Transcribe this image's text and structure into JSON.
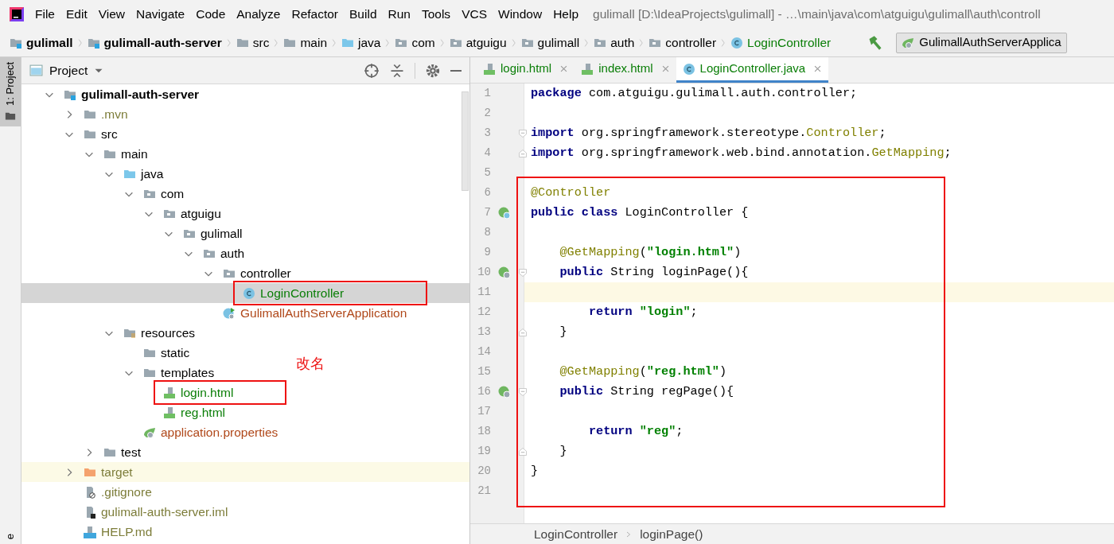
{
  "window": {
    "title": "gulimall [D:\\IdeaProjects\\gulimall] - …\\main\\java\\com\\atguigu\\gulimall\\auth\\controll"
  },
  "menu": [
    "File",
    "Edit",
    "View",
    "Navigate",
    "Code",
    "Analyze",
    "Refactor",
    "Build",
    "Run",
    "Tools",
    "VCS",
    "Window",
    "Help"
  ],
  "breadcrumb": [
    {
      "label": "gulimall",
      "kind": "module"
    },
    {
      "label": "gulimall-auth-server",
      "kind": "module"
    },
    {
      "label": "src",
      "kind": "folder"
    },
    {
      "label": "main",
      "kind": "folder"
    },
    {
      "label": "java",
      "kind": "source_folder"
    },
    {
      "label": "com",
      "kind": "package"
    },
    {
      "label": "atguigu",
      "kind": "package"
    },
    {
      "label": "gulimall",
      "kind": "package"
    },
    {
      "label": "auth",
      "kind": "package"
    },
    {
      "label": "controller",
      "kind": "package"
    },
    {
      "label": "LoginController",
      "kind": "class"
    }
  ],
  "run_config": {
    "label": "GulimallAuthServerApplica"
  },
  "side_tabs": [
    {
      "label": "1: Project",
      "selected": true
    },
    {
      "label": "e",
      "selected": false
    }
  ],
  "project_panel": {
    "title": "Project",
    "annotation": "改名"
  },
  "tree": [
    {
      "label": "gulimall-auth-server",
      "kind": "module",
      "expanded": true,
      "selected": false,
      "marked": false,
      "color": "#000000",
      "children": [
        {
          "label": ".mvn",
          "kind": "folder",
          "expanded": false,
          "selected": false,
          "marked": false,
          "color": "#7d7d3a"
        },
        {
          "label": "src",
          "kind": "folder",
          "expanded": true,
          "selected": false,
          "marked": false,
          "color": "#000000",
          "children": [
            {
              "label": "main",
              "kind": "folder",
              "expanded": true,
              "selected": false,
              "marked": false,
              "color": "#000000",
              "children": [
                {
                  "label": "java",
                  "kind": "source_folder",
                  "expanded": true,
                  "selected": false,
                  "marked": false,
                  "color": "#000000",
                  "children": [
                    {
                      "label": "com",
                      "kind": "package",
                      "expanded": true,
                      "selected": false,
                      "marked": false,
                      "color": "#000000",
                      "children": [
                        {
                          "label": "atguigu",
                          "kind": "package",
                          "expanded": true,
                          "selected": false,
                          "marked": false,
                          "color": "#000000",
                          "children": [
                            {
                              "label": "gulimall",
                              "kind": "package",
                              "expanded": true,
                              "selected": false,
                              "marked": false,
                              "color": "#000000",
                              "children": [
                                {
                                  "label": "auth",
                                  "kind": "package",
                                  "expanded": true,
                                  "selected": false,
                                  "marked": false,
                                  "color": "#000000",
                                  "children": [
                                    {
                                      "label": "controller",
                                      "kind": "package",
                                      "expanded": true,
                                      "selected": false,
                                      "marked": false,
                                      "color": "#000000",
                                      "children": [
                                        {
                                          "label": "LoginController",
                                          "kind": "class",
                                          "selected": true,
                                          "marked": true,
                                          "color": "#0a7e07"
                                        }
                                      ]
                                    },
                                    {
                                      "label": "GulimallAuthServerApplication",
                                      "kind": "boot_class",
                                      "selected": false,
                                      "marked": false,
                                      "color": "#b0481a"
                                    }
                                  ]
                                }
                              ]
                            }
                          ]
                        }
                      ]
                    }
                  ]
                },
                {
                  "label": "resources",
                  "kind": "resources",
                  "expanded": true,
                  "selected": false,
                  "marked": false,
                  "color": "#000000",
                  "children": [
                    {
                      "label": "static",
                      "kind": "folder",
                      "selected": false,
                      "marked": false,
                      "color": "#000000"
                    },
                    {
                      "label": "templates",
                      "kind": "folder",
                      "expanded": true,
                      "selected": false,
                      "marked": false,
                      "color": "#000000",
                      "children": [
                        {
                          "label": "login.html",
                          "kind": "html",
                          "selected": false,
                          "marked": true,
                          "color": "#0a7e07"
                        },
                        {
                          "label": "reg.html",
                          "kind": "html",
                          "selected": false,
                          "marked": false,
                          "color": "#0a7e07"
                        }
                      ]
                    },
                    {
                      "label": "application.properties",
                      "kind": "properties",
                      "selected": false,
                      "marked": false,
                      "color": "#b0481a"
                    }
                  ]
                }
              ]
            },
            {
              "label": "test",
              "kind": "folder",
              "expanded": false,
              "selected": false,
              "marked": false,
              "color": "#000000"
            }
          ]
        },
        {
          "label": "target",
          "kind": "excluded_folder",
          "expanded": false,
          "selected": false,
          "marked": false,
          "color": "#7d7d3a"
        },
        {
          "label": ".gitignore",
          "kind": "ignore_file",
          "selected": false,
          "marked": false,
          "color": "#7d7d3a"
        },
        {
          "label": "gulimall-auth-server.iml",
          "kind": "iml_file",
          "selected": false,
          "marked": false,
          "color": "#7d7d3a"
        },
        {
          "label": "HELP.md",
          "kind": "md_file",
          "selected": false,
          "marked": false,
          "color": "#7d7d3a"
        }
      ]
    }
  ],
  "editor_tabs": [
    {
      "label": "login.html",
      "kind": "html",
      "selected": false
    },
    {
      "label": "index.html",
      "kind": "html",
      "selected": false
    },
    {
      "label": "LoginController.java",
      "kind": "class",
      "selected": true
    }
  ],
  "code": [
    {
      "n": "1",
      "tokens": [
        {
          "kind": "keyword",
          "text": "package"
        },
        {
          "kind": "plain",
          "text": " com.atguigu.gulimall.auth.controller;"
        }
      ],
      "current": false
    },
    {
      "n": "2",
      "current": false
    },
    {
      "n": "3",
      "tokens": [
        {
          "kind": "keyword",
          "text": "import"
        },
        {
          "kind": "plain",
          "text": " org.springframework.stereotype."
        },
        {
          "kind": "annotation",
          "text": "Controller"
        },
        {
          "kind": "plain",
          "text": ";"
        }
      ],
      "fold": {
        "kind": "start"
      },
      "current": false
    },
    {
      "n": "4",
      "tokens": [
        {
          "kind": "keyword",
          "text": "import"
        },
        {
          "kind": "plain",
          "text": " org.springframework.web.bind.annotation."
        },
        {
          "kind": "annotation",
          "text": "GetMapping"
        },
        {
          "kind": "plain",
          "text": ";"
        }
      ],
      "fold": {
        "kind": "end"
      },
      "current": false
    },
    {
      "n": "5",
      "current": false
    },
    {
      "n": "6",
      "tokens": [
        {
          "kind": "annotation",
          "text": "@Controller"
        }
      ],
      "current": false
    },
    {
      "n": "7",
      "tokens": [
        {
          "kind": "keyword",
          "text": "public class"
        },
        {
          "kind": "plain",
          "text": " LoginController {"
        }
      ],
      "gutter": {
        "kind": "bean_class"
      },
      "current": false
    },
    {
      "n": "8",
      "current": false
    },
    {
      "n": "9",
      "tokens": [
        {
          "kind": "annotation",
          "text": "    @GetMapping"
        },
        {
          "kind": "plain",
          "text": "("
        },
        {
          "kind": "string",
          "text": "\"login.html\""
        },
        {
          "kind": "plain",
          "text": ")"
        }
      ],
      "current": false
    },
    {
      "n": "10",
      "tokens": [
        {
          "kind": "keyword",
          "text": "    public"
        },
        {
          "kind": "plain",
          "text": " String loginPage(){"
        }
      ],
      "gutter": {
        "kind": "bean_method"
      },
      "fold": {
        "kind": "start"
      },
      "current": false
    },
    {
      "n": "11",
      "current": true
    },
    {
      "n": "12",
      "tokens": [
        {
          "kind": "keyword",
          "text": "        return"
        },
        {
          "kind": "string",
          "text": " \"login\""
        },
        {
          "kind": "plain",
          "text": ";"
        }
      ],
      "current": false
    },
    {
      "n": "13",
      "tokens": [
        {
          "kind": "plain",
          "text": "    }"
        }
      ],
      "fold": {
        "kind": "end"
      },
      "current": false
    },
    {
      "n": "14",
      "current": false
    },
    {
      "n": "15",
      "tokens": [
        {
          "kind": "annotation",
          "text": "    @GetMapping"
        },
        {
          "kind": "plain",
          "text": "("
        },
        {
          "kind": "string",
          "text": "\"reg.html\""
        },
        {
          "kind": "plain",
          "text": ")"
        }
      ],
      "current": false
    },
    {
      "n": "16",
      "tokens": [
        {
          "kind": "keyword",
          "text": "    public"
        },
        {
          "kind": "plain",
          "text": " String regPage(){"
        }
      ],
      "gutter": {
        "kind": "bean_method"
      },
      "fold": {
        "kind": "start"
      },
      "current": false
    },
    {
      "n": "17",
      "current": false
    },
    {
      "n": "18",
      "tokens": [
        {
          "kind": "keyword",
          "text": "        return"
        },
        {
          "kind": "string",
          "text": " \"reg\""
        },
        {
          "kind": "plain",
          "text": ";"
        }
      ],
      "current": false
    },
    {
      "n": "19",
      "tokens": [
        {
          "kind": "plain",
          "text": "    }"
        }
      ],
      "fold": {
        "kind": "end"
      },
      "current": false
    },
    {
      "n": "20",
      "tokens": [
        {
          "kind": "plain",
          "text": "}"
        }
      ],
      "current": false
    },
    {
      "n": "21",
      "current": false
    }
  ],
  "editor_breadcrumb": [
    "LoginController",
    "loginPage()"
  ]
}
